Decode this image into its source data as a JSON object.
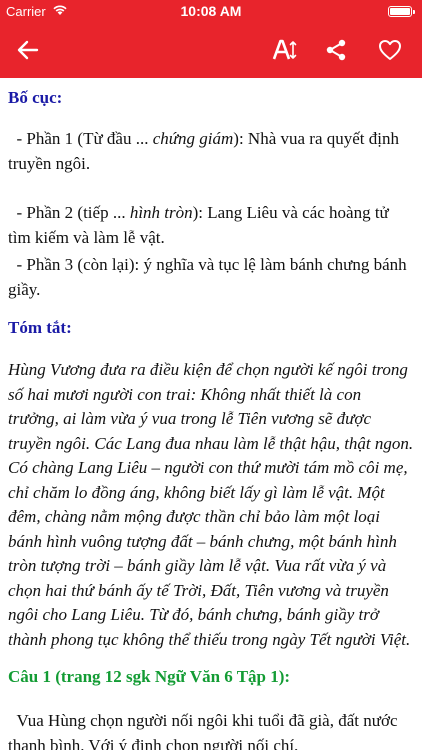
{
  "status": {
    "carrier": "Carrier",
    "time": "10:08 AM"
  },
  "nav": {
    "icons": [
      "back-arrow-icon",
      "font-size-icon",
      "share-icon",
      "heart-icon"
    ],
    "accent_color": "#e8242c"
  },
  "content": {
    "outline_heading": "Bố cục:",
    "part1_prefix": "- Phần 1 (Từ đầu ... ",
    "part1_italic": "chứng giám",
    "part1_suffix": "): Nhà vua ra quyết định truyền ngôi.",
    "part2_prefix": "- Phần 2 (tiếp ... ",
    "part2_italic": "hình tròn",
    "part2_suffix": "): Lang Liêu và các hoàng tử tìm kiếm và làm lễ vật.",
    "part3": "- Phần 3 (còn lại): ý nghĩa và tục lệ làm bánh chưng bánh giầy.",
    "summary_heading": "Tóm tắt:",
    "summary_text": "Hùng Vương đưa ra điều kiện để chọn người kế ngôi trong số hai mươi người con trai: Không nhất thiết là con trưởng, ai làm vừa ý vua trong lễ Tiên vương sẽ được truyền ngôi. Các Lang đua nhau làm lễ thật hậu, thật ngon. Có chàng Lang Liêu – người con thứ mười tám mồ côi mẹ, chỉ chăm lo đồng áng, không biết lấy gì làm lễ vật. Một đêm, chàng nằm mộng được thần chỉ bảo làm một loại bánh hình vuông tượng đất – bánh chưng, một bánh hình tròn tượng trời – bánh giầy làm lễ vật. Vua rất vừa ý và chọn hai thứ bánh ấy tế Trời, Đất, Tiên vương và truyền ngôi cho Lang Liêu. Từ đó, bánh chưng, bánh giầy trở thành phong tục không thể thiếu trong ngày Tết người Việt.",
    "question_heading": "Câu 1 (trang 12 sgk Ngữ Văn 6 Tập 1):",
    "answer_text": "Vua Hùng chọn người nối ngôi khi tuổi đã già, đất nước thanh bình. Với ý định chọn người nối chí,"
  },
  "colors": {
    "heading_blue": "#1a1aa6",
    "heading_green": "#139c34"
  }
}
